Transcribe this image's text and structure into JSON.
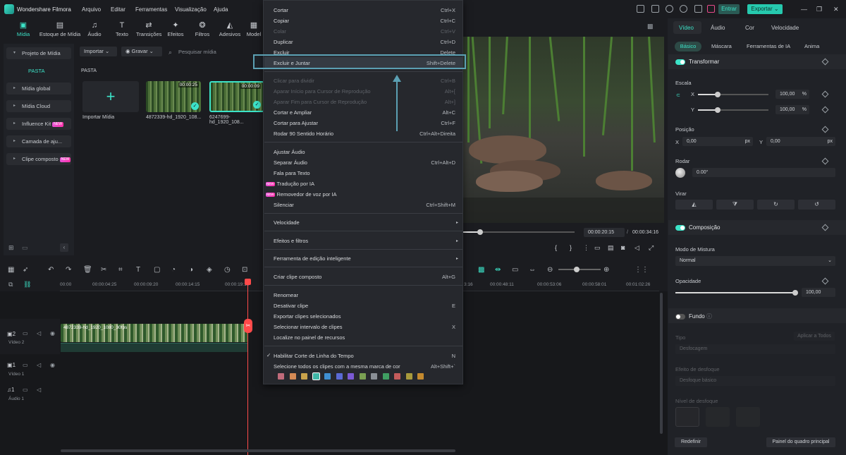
{
  "titlebar": {
    "app_title": "Wondershare Filmora",
    "menus": [
      "Arquivo",
      "Editar",
      "Ferramentas",
      "Visualização",
      "Ajuda"
    ],
    "login_label": "Entrar",
    "export_label": "Exportar"
  },
  "toolbar": {
    "items": [
      {
        "label": "Mídia",
        "icon": "media-icon"
      },
      {
        "label": "Estoque de Mídia",
        "icon": "stock-icon"
      },
      {
        "label": "Áudio",
        "icon": "music-icon"
      },
      {
        "label": "Texto",
        "icon": "text-icon"
      },
      {
        "label": "Transições",
        "icon": "transition-icon"
      },
      {
        "label": "Efeitos",
        "icon": "effects-icon"
      },
      {
        "label": "Filtros",
        "icon": "filters-icon"
      },
      {
        "label": "Adesivos",
        "icon": "stickers-icon"
      },
      {
        "label": "Model",
        "icon": "template-icon"
      }
    ]
  },
  "sidebar": {
    "items": [
      {
        "label": "Projeto de Mídia"
      },
      {
        "label": "PASTA"
      },
      {
        "label": "Mídia global"
      },
      {
        "label": "Mídia Cloud"
      },
      {
        "label": "Influence Kit",
        "badge": "NEW"
      },
      {
        "label": "Camada de aju..."
      },
      {
        "label": "Clipe composto",
        "badge": "NEW"
      }
    ]
  },
  "media": {
    "import_dropdown": "Importar",
    "record_dropdown": "Gravar",
    "search_placeholder": "Pesquisar mídia",
    "folder_label": "PASTA",
    "import_tile_label": "Importar Mídia",
    "clips": [
      {
        "name": "4872339-hd_1920_108...",
        "duration": "00:00:25"
      },
      {
        "name": "6247699-hd_1920_108...",
        "duration": "00:00:09"
      }
    ]
  },
  "preview": {
    "current_time": "00:00:20:15",
    "total_time": "00:00:34:16"
  },
  "context_menu": {
    "items": [
      {
        "label": "Cortar",
        "shortcut": "Ctrl+X",
        "disabled": false
      },
      {
        "label": "Copiar",
        "shortcut": "Ctrl+C",
        "disabled": false
      },
      {
        "label": "Colar",
        "shortcut": "Ctrl+V",
        "disabled": true
      },
      {
        "label": "Duplicar",
        "shortcut": "Ctrl+D",
        "disabled": false
      },
      {
        "label": "Excluir",
        "shortcut": "Delete",
        "disabled": false
      },
      {
        "label": "Excluir e Juntar",
        "shortcut": "Shift+Delete",
        "disabled": false
      },
      {
        "label": "Clicar para dividir",
        "shortcut": "Ctrl+B",
        "disabled": true
      },
      {
        "label": "Aparar Início para Cursor de Reprodução",
        "shortcut": "Alt+[",
        "disabled": true
      },
      {
        "label": "Aparar Fim para Cursor de Reprodução",
        "shortcut": "Alt+]",
        "disabled": true
      },
      {
        "label": "Cortar e Ampliar",
        "shortcut": "Alt+C",
        "disabled": false
      },
      {
        "label": "Cortar para Ajustar",
        "shortcut": "Ctrl+F",
        "disabled": false
      },
      {
        "label": "Rodar 90 Sentido Horário",
        "shortcut": "Ctrl+Alt+Direita",
        "disabled": false
      },
      {
        "label": "Ajustar Áudio",
        "shortcut": "",
        "disabled": false
      },
      {
        "label": "Separar Áudio",
        "shortcut": "Ctrl+Alt+D",
        "disabled": false
      },
      {
        "label": "Fala para Texto",
        "shortcut": "",
        "disabled": false
      },
      {
        "label": "Tradução por IA",
        "shortcut": "",
        "disabled": false,
        "badge": "NEW"
      },
      {
        "label": "Removedor de voz por IA",
        "shortcut": "",
        "disabled": false,
        "badge": "NEW"
      },
      {
        "label": "Silenciar",
        "shortcut": "Ctrl+Shift+M",
        "disabled": false
      },
      {
        "label": "Velocidade",
        "shortcut": "",
        "disabled": false,
        "submenu": true
      },
      {
        "label": "Efeitos e filtros",
        "shortcut": "",
        "disabled": false,
        "submenu": true
      },
      {
        "label": "Ferramenta de edição inteligente",
        "shortcut": "",
        "disabled": false,
        "submenu": true
      },
      {
        "label": "Criar clipe composto",
        "shortcut": "Alt+G",
        "disabled": false
      },
      {
        "label": "Renomear",
        "shortcut": "",
        "disabled": false
      },
      {
        "label": "Desativar clipe",
        "shortcut": "E",
        "disabled": false
      },
      {
        "label": "Exportar clipes selecionados",
        "shortcut": "",
        "disabled": false
      },
      {
        "label": "Selecionar intervalo de clipes",
        "shortcut": "X",
        "disabled": false
      },
      {
        "label": "Localize no painel de recursos",
        "shortcut": "",
        "disabled": false
      },
      {
        "label": "Habilitar Corte de Linha do Tempo",
        "shortcut": "N",
        "disabled": false,
        "checked": true
      },
      {
        "label": "Selecione todos os clipes com a mesma marca de cor",
        "shortcut": "Alt+Shift+`",
        "disabled": false
      }
    ],
    "color_swatches": [
      "#c06b7a",
      "#d48a55",
      "#c9a34b",
      "#3fb6a6",
      "#3f8fd1",
      "#5a6ad4",
      "#7b5ad4",
      "#7aa052",
      "#8a8f96",
      "#3f9e62",
      "#c45b5b",
      "#a89a3c",
      "#c48a2e"
    ]
  },
  "properties": {
    "tabs": [
      "Vídeo",
      "Áudio",
      "Cor",
      "Velocidade"
    ],
    "subtabs": [
      "Básico",
      "Máscara",
      "Ferramentas de IA",
      "Anima"
    ],
    "transform_label": "Transformar",
    "scale_label": "Escala",
    "scale_x": "100,00",
    "scale_y": "100,00",
    "scale_unit": "%",
    "scale_value": 1.0,
    "position_label": "Posição",
    "pos_x": "0,00",
    "pos_y": "0,00",
    "px_unit": "px",
    "rotate_label": "Rodar",
    "rotate_value": "0.00°",
    "flip_label": "Virar",
    "composition_label": "Composição",
    "blend_label": "Modo de Mistura",
    "blend_value": "Normal",
    "opacity_label": "Opacidade",
    "opacity_value": "100,00",
    "opacity_level": 1.0,
    "background_label": "Fundo",
    "type_label": "Tipo",
    "apply_all": "Aplicar a Todos",
    "type_value": "Desfocagem",
    "blur_effect_label": "Efeito de desfoque",
    "blur_effect_value": "Desfoque básico",
    "blur_level_label": "Nível de desfoque",
    "reset_label": "Redefinir",
    "keyframe_panel_label": "Painel do quadro principal"
  },
  "timeline": {
    "ticks": [
      "00:00",
      "00:00:04:25",
      "00:00:09:20",
      "00:00:14:15",
      "00:00:19:10",
      "3:16",
      "00:00:48:11",
      "00:00:53:06",
      "00:00:58:01",
      "00:01:02:26"
    ],
    "tracks": [
      {
        "num": "2",
        "name": "Vídeo 2"
      },
      {
        "num": "1",
        "name": "Vídeo 1"
      },
      {
        "num": "1",
        "name": "Áudio 1"
      }
    ],
    "clip_title": "4872339-hd_1920_1080_30fps"
  }
}
